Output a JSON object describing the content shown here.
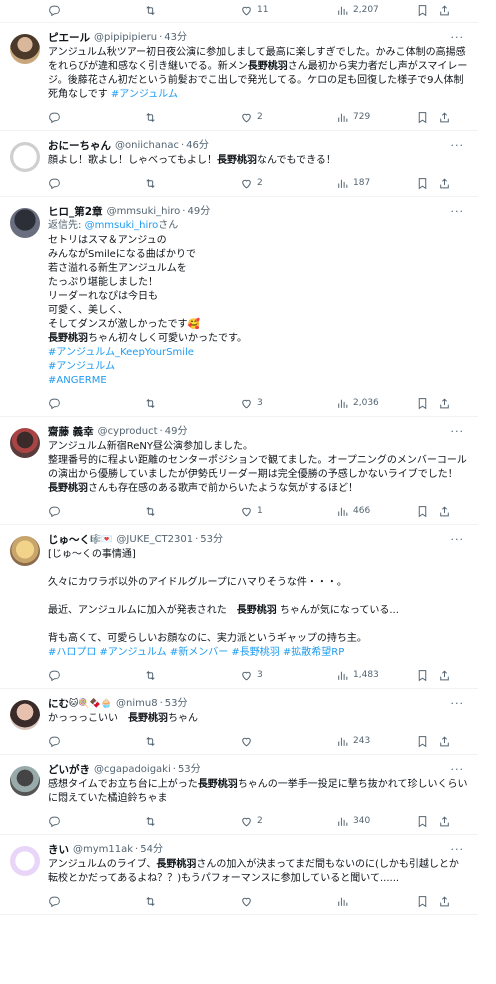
{
  "top_partial": {
    "likes": "11",
    "views": "2,207"
  },
  "tweets": [
    {
      "name": "ピエール",
      "handle": "@pipipipieru",
      "time": "43分",
      "segments": [
        {
          "t": "アンジュルム秋ツアー初日夜公演に参加しまして最高に楽しすぎでした。かみこ体制の高揚感をれらびが違和感なく引き継いでる。新メン"
        },
        {
          "t": "長野桃羽",
          "s": "hl"
        },
        {
          "t": "さん最初から実力者だし声がスマイレージ。後藤花さん初だという前髪おでこ出しで発光してる。ケロの足も回復した様子で9人体制死角なしです "
        },
        {
          "t": "#アンジュルム",
          "s": "tag"
        }
      ],
      "likes": "2",
      "views": "729"
    },
    {
      "name": "おにーちゃん",
      "handle": "@oniichanac",
      "time": "46分",
      "segments": [
        {
          "t": "顔よし！歌よし！しゃべってもよし！"
        },
        {
          "t": "長野桃羽",
          "s": "hl"
        },
        {
          "t": "なんでもできる！"
        }
      ],
      "likes": "2",
      "views": "187"
    },
    {
      "name": "ヒロ_第2章",
      "handle": "@mmsuki_hiro",
      "time": "49分",
      "reply_to_label": "返信先: ",
      "reply_to_handle": "@mmsuki_hiro",
      "reply_to_suffix": "さん",
      "segments": [
        {
          "t": "セトリはスマ＆アンジュの\nみんながSmileになる曲ばかりで\n若さ溢れる新生アンジュルムを\nたっぷり堪能しました！\nリーダーれなぴは今日も\n可愛く、美しく、\nそしてダンスが激しかったです🥰\n"
        },
        {
          "t": "長野桃羽",
          "s": "hl"
        },
        {
          "t": "ちゃん初々しく可愛いかったです。\n"
        },
        {
          "t": "#アンジュルム_KeepYourSmile\n#アンジュルム\n#ANGERME",
          "s": "tag"
        }
      ],
      "likes": "3",
      "views": "2,036"
    },
    {
      "name": "齋藤 義幸",
      "handle": "@cyproduct",
      "time": "49分",
      "segments": [
        {
          "t": "アンジュルム新宿ReNY昼公演参加しました。\n整理番号的に程よい距離のセンターポジションで観てました。オープニングのメンバーコールの演出から優勝していましたが伊勢氏リーダー期は完全優勝の予感しかないライブでした！\n"
        },
        {
          "t": "長野桃羽",
          "s": "hl"
        },
        {
          "t": "さんも存在感のある歌声で前からいたような気がするほど！"
        }
      ],
      "likes": "1",
      "views": "466"
    },
    {
      "name": "じゅ〜く",
      "name_emoji": "🎼💌",
      "handle": "@JUKE_CT2301",
      "time": "53分",
      "segments": [
        {
          "t": "[じゅ〜くの事情通]\n\n久々にカワラボ以外のアイドルグループにハマりそうな件・・・。\n\n最近、アンジュルムに加入が発表された　"
        },
        {
          "t": "長野桃羽",
          "s": "hl"
        },
        {
          "t": " ちゃんが気になっている...\n\n背も高くて、可愛らしいお顔なのに、実力派というギャップの持ち主。\n"
        },
        {
          "t": "#ハロプロ #アンジュルム #新メンバー #長野桃羽 #拡散希望RP",
          "s": "tag"
        }
      ],
      "likes": "3",
      "views": "1,483"
    },
    {
      "name": "にむ",
      "name_emoji": "🐱🍭🍫🧁",
      "handle": "@nimu8",
      "time": "53分",
      "segments": [
        {
          "t": "かっっっこいい　"
        },
        {
          "t": "長野桃羽",
          "s": "hl"
        },
        {
          "t": "ちゃん"
        }
      ],
      "likes": "",
      "views": "243"
    },
    {
      "name": "どいがき",
      "handle": "@cgapadoigaki",
      "time": "53分",
      "segments": [
        {
          "t": "感想タイムでお立ち台に上がった"
        },
        {
          "t": "長野桃羽",
          "s": "hl"
        },
        {
          "t": "ちゃんの一挙手一投足に撃ち抜かれて珍しいくらいに悶えていた橘迫鈴ちゃま"
        }
      ],
      "likes": "2",
      "views": "340"
    },
    {
      "name": "きい",
      "handle": "@mym11ak",
      "time": "54分",
      "segments": [
        {
          "t": "アンジュルムのライブ、"
        },
        {
          "t": "長野桃羽",
          "s": "hl"
        },
        {
          "t": "さんの加入が決まってまだ間もないのに(しかも引越しとか転校とかだってあるよね？？)もうパフォーマンスに参加していると聞いて......"
        }
      ],
      "likes": "",
      "views": ""
    }
  ],
  "icons": [
    "reply-icon",
    "retweet-icon",
    "like-icon",
    "views-icon",
    "bookmark-icon",
    "share-icon",
    "more-icon"
  ],
  "colors": {
    "link": "#1d9bf0",
    "muted": "#536471",
    "text": "#0f1419",
    "divider": "#eff3f4"
  }
}
